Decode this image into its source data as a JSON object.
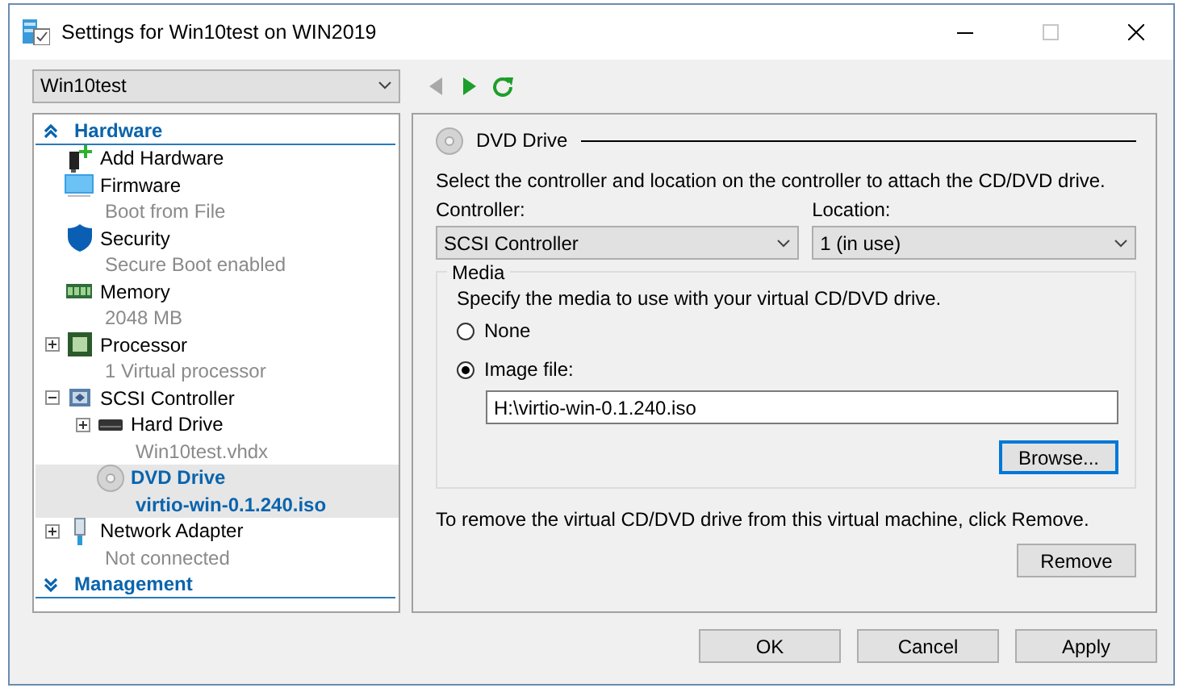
{
  "window": {
    "title": "Settings for Win10test on WIN2019"
  },
  "vm_selector": {
    "value": "Win10test"
  },
  "toolbar": [
    {
      "kind": "back",
      "disabled": true
    },
    {
      "kind": "forward",
      "disabled": false
    },
    {
      "kind": "refresh",
      "disabled": false
    }
  ],
  "sidebar": {
    "sections": [
      {
        "label": "Hardware",
        "expanded": true,
        "items": [
          {
            "kind": "add",
            "name": "Add Hardware",
            "selected": false
          },
          {
            "kind": "firmware",
            "name": "Firmware",
            "detail": "Boot from File",
            "selected": false
          },
          {
            "kind": "security",
            "name": "Security",
            "detail": "Secure Boot enabled",
            "selected": false
          },
          {
            "kind": "memory",
            "name": "Memory",
            "detail": "2048 MB",
            "selected": false
          },
          {
            "kind": "processor",
            "name": "Processor",
            "detail": "1 Virtual processor",
            "selected": false,
            "expanded": false
          },
          {
            "kind": "controller",
            "name": "SCSI Controller",
            "selected": false,
            "expanded": true,
            "children": [
              {
                "kind": "disk",
                "name": "Hard Drive",
                "detail": "Win10test.vhdx",
                "selected": false,
                "expanded": false
              },
              {
                "kind": "dvd",
                "name": "DVD Drive",
                "detail": "virtio-win-0.1.240.iso",
                "selected": true
              }
            ]
          },
          {
            "kind": "network",
            "name": "Network Adapter",
            "detail": "Not connected",
            "selected": false,
            "expanded": false
          }
        ]
      },
      {
        "label": "Management",
        "expanded": false
      }
    ]
  },
  "panel": {
    "title": "DVD Drive",
    "intro": "Select the controller and location on the controller to attach the CD/DVD drive.",
    "controller": {
      "label": "Controller:",
      "value": "SCSI Controller"
    },
    "location": {
      "label": "Location:",
      "value": "1 (in use)"
    },
    "media": {
      "legend": "Media",
      "hint": "Specify the media to use with your virtual CD/DVD drive.",
      "options": [
        {
          "label": "None",
          "selected": false
        },
        {
          "label": "Image file:",
          "selected": true
        }
      ],
      "path": "H:\\virtio-win-0.1.240.iso",
      "browse": "Browse..."
    },
    "remove_hint": "To remove the virtual CD/DVD drive from this virtual machine, click Remove.",
    "remove": "Remove"
  },
  "buttons": [
    "OK",
    "Cancel",
    "Apply"
  ]
}
